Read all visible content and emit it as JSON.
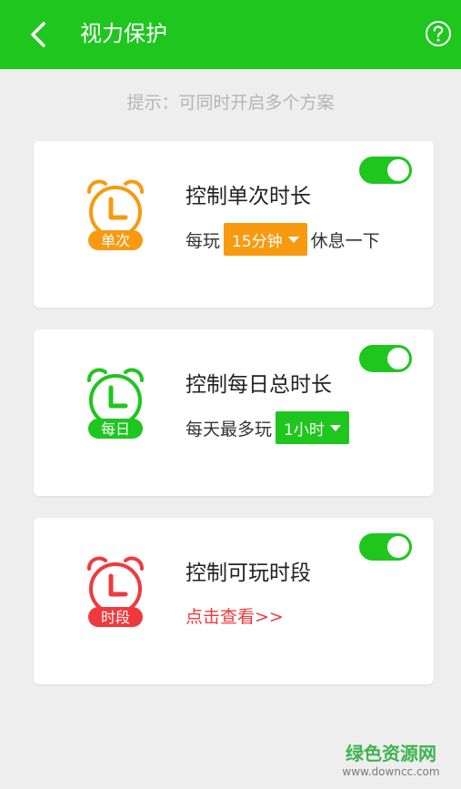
{
  "header": {
    "title": "视力保护",
    "back_icon": "chevron-left-icon",
    "help_icon": "help-circle-icon"
  },
  "hint": "提示：可同时开启多个方案",
  "colors": {
    "green": "#1ec61e",
    "orange": "#f79a10",
    "red": "#f0393e"
  },
  "cards": [
    {
      "icon": "alarm-clock-icon",
      "badge": "单次",
      "title": "控制单次时长",
      "prefix": "每玩",
      "dropdown": "15分钟",
      "suffix": "休息一下",
      "toggle_on": true
    },
    {
      "icon": "alarm-clock-icon",
      "badge": "每日",
      "title": "控制每日总时长",
      "prefix": "每天最多玩",
      "dropdown": "1小时",
      "toggle_on": true
    },
    {
      "icon": "alarm-clock-icon",
      "badge": "时段",
      "title": "控制可玩时段",
      "link": "点击查看>>",
      "toggle_on": true
    }
  ],
  "watermark": {
    "main": "绿色资源网",
    "sub": "www.downcc.com"
  }
}
